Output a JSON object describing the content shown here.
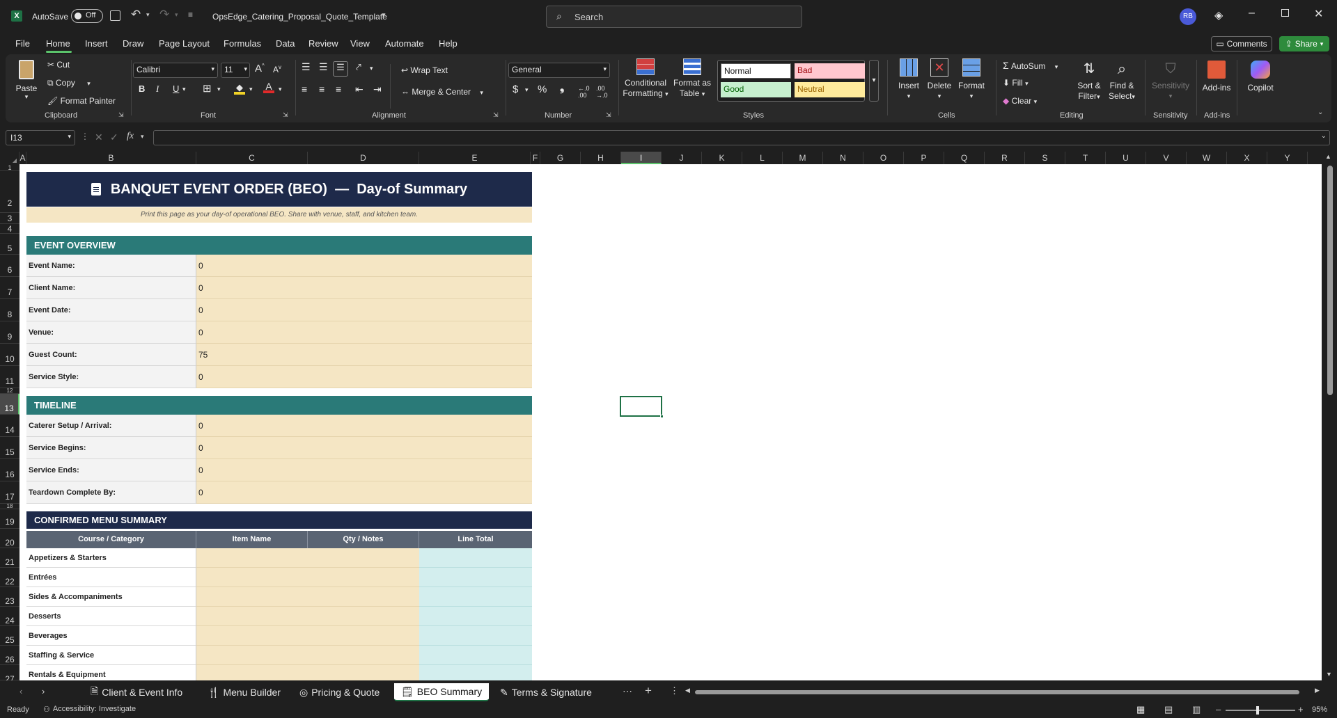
{
  "titlebar": {
    "autosave_label": "AutoSave",
    "autosave_state": "Off",
    "filename": "OpsEdge_Catering_Proposal_Quote_Template",
    "search_placeholder": "Search",
    "user_initials": "RB"
  },
  "menu": {
    "items": [
      "File",
      "Home",
      "Insert",
      "Draw",
      "Page Layout",
      "Formulas",
      "Data",
      "Review",
      "View",
      "Automate",
      "Help"
    ],
    "active": "Home",
    "comments_label": "Comments",
    "share_label": "Share"
  },
  "ribbon": {
    "clipboard": {
      "paste": "Paste",
      "cut": "Cut",
      "copy": "Copy",
      "format_painter": "Format Painter",
      "label": "Clipboard"
    },
    "font": {
      "name": "Calibri",
      "size": "11",
      "label": "Font"
    },
    "alignment": {
      "wrap_text": "Wrap Text",
      "merge_center": "Merge & Center",
      "label": "Alignment"
    },
    "number": {
      "format": "General",
      "label": "Number"
    },
    "styles": {
      "conditional": "Conditional",
      "formatting": "Formatting",
      "format_as": "Format as",
      "table": "Table",
      "normal": "Normal",
      "bad": "Bad",
      "good": "Good",
      "neutral": "Neutral",
      "label": "Styles"
    },
    "cells": {
      "insert": "Insert",
      "delete": "Delete",
      "format": "Format",
      "label": "Cells"
    },
    "editing": {
      "autosum": "AutoSum",
      "fill": "Fill",
      "clear": "Clear",
      "sort": "Sort &",
      "filter": "Filter",
      "find": "Find &",
      "select": "Select",
      "label": "Editing"
    },
    "sensitivity": {
      "button": "Sensitivity",
      "label": "Sensitivity"
    },
    "addins": {
      "button": "Add-ins",
      "label": "Add-ins"
    },
    "copilot": {
      "button": "Copilot"
    }
  },
  "formula_bar": {
    "name_box": "I13",
    "fx": "fx",
    "content": ""
  },
  "columns": [
    "A",
    "B",
    "C",
    "D",
    "E",
    "F",
    "G",
    "H",
    "I",
    "J",
    "K",
    "L",
    "M",
    "N",
    "O",
    "P",
    "Q",
    "R",
    "S",
    "T",
    "U",
    "V",
    "W",
    "X",
    "Y"
  ],
  "rows": [
    "1",
    "2",
    "3",
    "4",
    "5",
    "6",
    "7",
    "8",
    "9",
    "10",
    "11",
    "12",
    "13",
    "14",
    "15",
    "16",
    "17",
    "18",
    "19",
    "20",
    "21",
    "22",
    "23",
    "24",
    "25",
    "26",
    "27"
  ],
  "sheet": {
    "title": "BANQUET EVENT ORDER (BEO)  —  Day-of Summary",
    "subtitle": "Print this page as your day-of operational BEO. Share with venue, staff, and kitchen team.",
    "overview_header": "EVENT OVERVIEW",
    "overview": [
      {
        "label": "Event Name:",
        "value": "0"
      },
      {
        "label": "Client Name:",
        "value": "0"
      },
      {
        "label": "Event Date:",
        "value": "0"
      },
      {
        "label": "Venue:",
        "value": "0"
      },
      {
        "label": "Guest Count:",
        "value": "75"
      },
      {
        "label": "Service Style:",
        "value": "0"
      }
    ],
    "timeline_header": "TIMELINE",
    "timeline": [
      {
        "label": "Caterer Setup / Arrival:",
        "value": "0"
      },
      {
        "label": "Service Begins:",
        "value": "0"
      },
      {
        "label": "Service Ends:",
        "value": "0"
      },
      {
        "label": "Teardown Complete By:",
        "value": "0"
      }
    ],
    "menu_header": "CONFIRMED MENU SUMMARY",
    "menu_columns": [
      "Course / Category",
      "Item Name",
      "Qty / Notes",
      "Line Total"
    ],
    "menu_rows": [
      "Appetizers & Starters",
      "Entrées",
      "Sides & Accompaniments",
      "Desserts",
      "Beverages",
      "Staffing & Service",
      "Rentals & Equipment"
    ]
  },
  "tabs": {
    "items": [
      "Client & Event Info",
      "Menu Builder",
      "Pricing & Quote",
      "BEO Summary",
      "Terms & Signature"
    ],
    "active": "BEO Summary"
  },
  "status": {
    "ready": "Ready",
    "accessibility": "Accessibility: Investigate",
    "zoom": "95%"
  },
  "colors": {
    "teal": "#2a7a78",
    "navy": "#1e2a4a",
    "tan": "#f5e6c4",
    "aqua": "#d3eeee",
    "share": "#2e8b3c"
  }
}
